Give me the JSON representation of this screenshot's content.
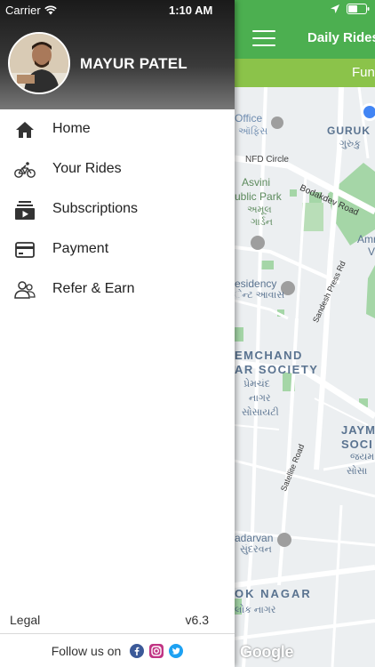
{
  "status_bar": {
    "carrier": "Carrier",
    "time": "1:10 AM"
  },
  "user": {
    "name": "MAYUR PATEL"
  },
  "menu": {
    "items": [
      {
        "label": "Home",
        "icon": "home-icon"
      },
      {
        "label": "Your Rides",
        "icon": "bicycle-icon"
      },
      {
        "label": "Subscriptions",
        "icon": "subscriptions-icon"
      },
      {
        "label": "Payment",
        "icon": "credit-card-icon"
      },
      {
        "label": "Refer & Earn",
        "icon": "refer-users-icon"
      }
    ]
  },
  "footer": {
    "legal": "Legal",
    "version": "v6.3",
    "follow_text": "Follow us on",
    "social": [
      "facebook-icon",
      "instagram-icon",
      "twitter-icon"
    ]
  },
  "background_app": {
    "title": "Daily Rides",
    "banner": "Fun",
    "map_labels": {
      "office": "Office",
      "office_gu": "ઑફિસ",
      "guruk": "GURUK",
      "guruk_gu": "ગુરુકુ",
      "nfd_circle": "NFD Circle",
      "bodakdev_road": "Bodakdev Road",
      "asvini": "Asvini",
      "public_park": "ublic Park",
      "park_gu": "અમૂલ",
      "garden_gu": "ગાર્ડન",
      "amr": "Amr",
      "amr2": "V",
      "residency": "esidency",
      "residency_gu": "ેન્ટ આવાસ",
      "sandesh_press": "Sandesh Press Rd",
      "premchand": "EMCHAND",
      "society": "AR SOCIETY",
      "premchand_gu": "પ્રેમચંદ",
      "nagar_gu": "નાગર",
      "society_gu": "સોસાયટી",
      "jaym": "JAYM",
      "soci": "SOCI",
      "jaym_gu": "જયમ",
      "soci_gu": "સોસા",
      "satellite_road": "Satellite Road",
      "sundarvan": "adarvan",
      "sundarvan_gu": "સુંદરવન",
      "ok_nagar": "OK NAGAR",
      "ok_nagar_gu": "લોક નાગર",
      "google": "Google"
    }
  },
  "colors": {
    "header_green": "#4caf50",
    "banner_green": "#8bc34a",
    "map_park": "#a5d6a7",
    "map_road": "#ffffff",
    "map_bg": "#eceff1"
  }
}
